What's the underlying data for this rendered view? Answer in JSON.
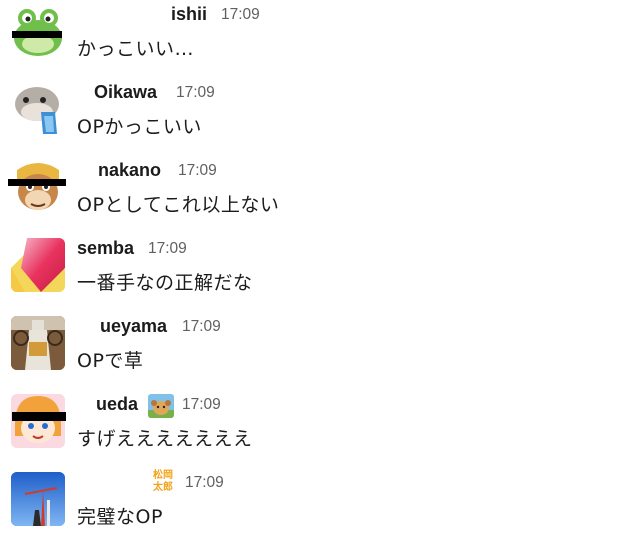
{
  "messages": [
    {
      "user": "ishii",
      "time": "17:09",
      "text": "かっこいい…",
      "avatar": "green-frog-avatar"
    },
    {
      "user": "Oikawa",
      "time": "17:09",
      "text": "OPかっこいい",
      "avatar": "pufferfish-avatar"
    },
    {
      "user": "nakano",
      "time": "17:09",
      "text": "OPとしてこれ以上ない",
      "avatar": "cartoon-face-avatar"
    },
    {
      "user": "semba",
      "time": "17:09",
      "text": "一番手なの正解だな",
      "avatar": "gradient-logo-avatar"
    },
    {
      "user": "ueyama",
      "time": "17:09",
      "text": "OPで草",
      "avatar": "bottle-photo-avatar"
    },
    {
      "user": "ueda",
      "time": "17:09",
      "text": "すげえええええええ",
      "avatar": "anime-girl-avatar",
      "status_emoji": "dog-emoji"
    },
    {
      "user": "",
      "time": "17:09",
      "text": "完璧なOP",
      "avatar": "sky-crane-avatar",
      "name_stamp": "松岡\n太郎"
    }
  ],
  "colors": {
    "name": "#1d1c1d",
    "time": "#616061",
    "text": "#1d1c1d",
    "stamp": "#f2a31a"
  }
}
